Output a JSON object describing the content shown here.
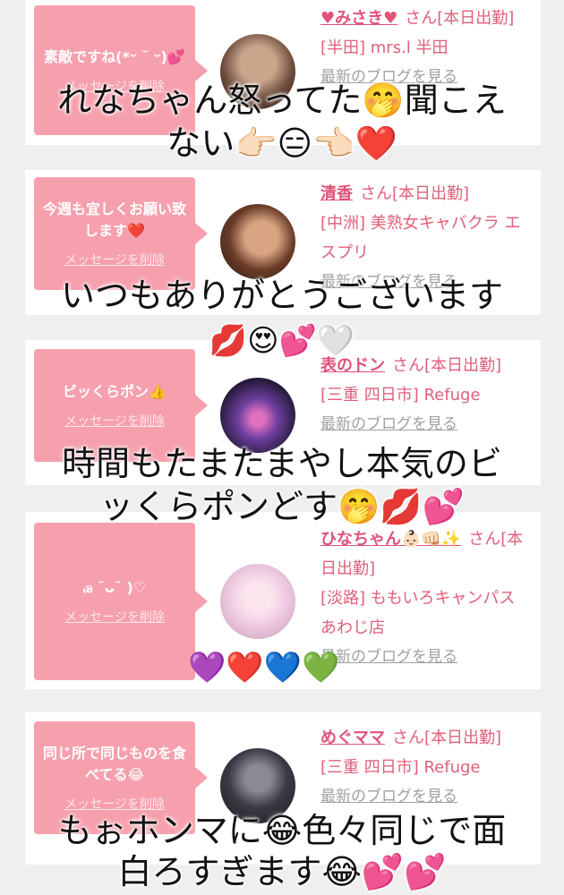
{
  "cards": [
    {
      "message": "素敵ですね(*ᵕ ˘ ᵕ)💕",
      "delete_label": "メッセージを削除",
      "name": "♥みさき♥",
      "suffix": "さん[本日出勤]",
      "shop": "[半田] mrs.l 半田",
      "blog_label": "最新のブログを見る",
      "avatar_colors": [
        "#6b4a3a",
        "#c9a58c"
      ]
    },
    {
      "message": "今週も宜しくお願い致します❤️",
      "delete_label": "メッセージを削除",
      "name": "清香",
      "suffix": "さん[本日出勤]",
      "shop": "[中洲] 美熟女キャバクラ エスプリ",
      "blog_label": "最新のブログを見る",
      "avatar_colors": [
        "#3a2418",
        "#d8a482"
      ]
    },
    {
      "message": "ビッくらポン👍",
      "delete_label": "メッセージを削除",
      "name": "表のドン",
      "suffix": "さん[本日出勤]",
      "shop": "[三重 四日市] Refuge",
      "blog_label": "最新のブログを見る",
      "avatar_colors": [
        "#101020",
        "#7040a0"
      ]
    },
    {
      "message": "ꮚ ˘ᴗ˘ )♡",
      "delete_label": "メッセージを削除",
      "name": "ひなちゃん👶🏻👊🏻✨",
      "suffix": "さん[本日出勤]",
      "shop": "[淡路] ももいろキャンパス あわじ店",
      "blog_label": "最新のブログを見る",
      "avatar_colors": [
        "#f2d0e4",
        "#c89ab8"
      ]
    },
    {
      "message": "同じ所で同じものを食べてる😂",
      "delete_label": "メッセージを削除",
      "name": "めぐママ",
      "suffix": "さん[本日出勤]",
      "shop": "[三重 四日市] Refuge",
      "blog_label": "最新のブログを見る",
      "avatar_colors": [
        "#2a2a30",
        "#8a8a96"
      ]
    }
  ],
  "overlays": {
    "line1": "れなちゃん怒ってた🤭聞こえ",
    "line2": "ない👉🏻😑👈🏻❤️",
    "line3": "いつもありがとうございます",
    "line4": "💋😍💕🤍",
    "line5": "時間もたまたまやし本気のビ",
    "line6": "ッくらポンどす🤭💋💕",
    "hearts": "💜❤️💙💚",
    "line7": "もぉホンマに😂色々同じで面",
    "line8": "白ろすぎます😂💕💕"
  },
  "colors": {
    "bubble": "#f6a0ad",
    "name": "#e0527a",
    "link": "#a0a0a0"
  }
}
